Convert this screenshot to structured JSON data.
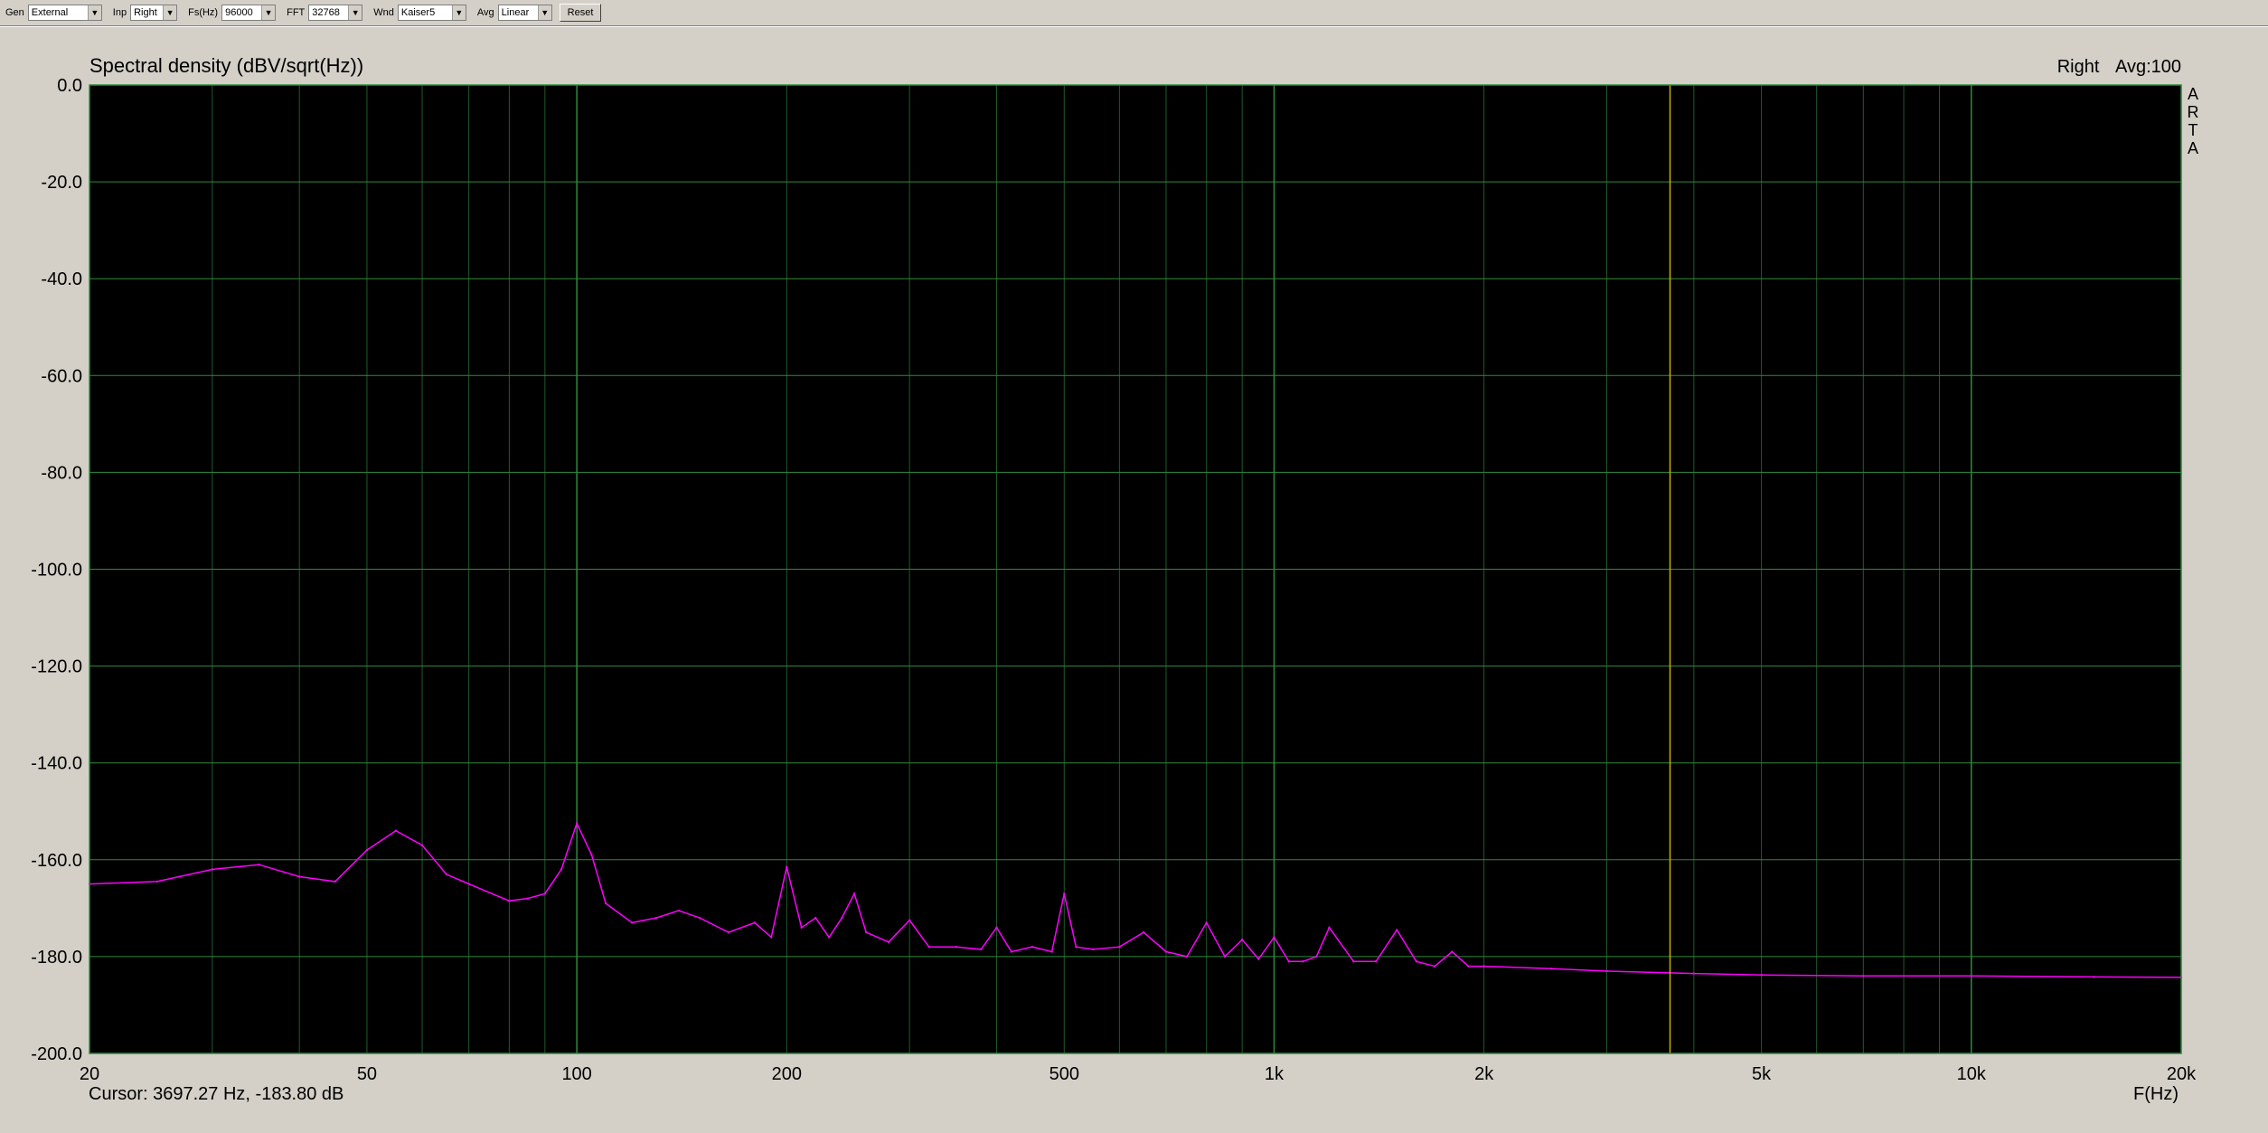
{
  "toolbar": {
    "gen_label": "Gen",
    "gen_value": "External",
    "inp_label": "Inp",
    "inp_value": "Right",
    "fs_label": "Fs(Hz)",
    "fs_value": "96000",
    "fft_label": "FFT",
    "fft_value": "32768",
    "wnd_label": "Wnd",
    "wnd_value": "Kaiser5",
    "avg_label": "Avg",
    "avg_value": "Linear",
    "reset_label": "Reset"
  },
  "status": {
    "channel": "Right",
    "averages": "Avg:100",
    "cursor": "Cursor: 3697.27 Hz, -183.80 dB"
  },
  "watermark": [
    "A",
    "R",
    "T",
    "A"
  ],
  "colors": {
    "plot_background": "#000000",
    "grid": "#1f5a2a",
    "grid_major": "#2e8b3c",
    "trace": "#ff00ff",
    "cursor_line": "#c8b400"
  },
  "chart_data": {
    "type": "line",
    "title": "Spectral density (dBV/sqrt(Hz))",
    "xlabel": "F(Hz)",
    "x_scale": "log",
    "xlim": [
      20,
      20000
    ],
    "ylim": [
      -200,
      0
    ],
    "x_ticks": [
      20,
      50,
      100,
      200,
      500,
      1000,
      2000,
      5000,
      10000,
      20000
    ],
    "x_tick_labels": [
      "20",
      "50",
      "100",
      "200",
      "500",
      "1k",
      "2k",
      "5k",
      "10k",
      "20k"
    ],
    "y_ticks": [
      0,
      -20,
      -40,
      -60,
      -80,
      -100,
      -120,
      -140,
      -160,
      -180,
      -200
    ],
    "y_tick_labels": [
      "0.0",
      "-20.0",
      "-40.0",
      "-60.0",
      "-80.0",
      "-100.0",
      "-120.0",
      "-140.0",
      "-160.0",
      "-180.0",
      "-200.0"
    ],
    "grid": true,
    "cursor_x": 3697.27,
    "series": [
      {
        "x": [
          20,
          25,
          30,
          35,
          40,
          45,
          50,
          55,
          60,
          65,
          70,
          80,
          85,
          90,
          95,
          100,
          105,
          110,
          120,
          130,
          140,
          150,
          165,
          180,
          190,
          200,
          210,
          220,
          230,
          240,
          250,
          260,
          280,
          300,
          320,
          350,
          380,
          400,
          420,
          450,
          480,
          500,
          520,
          550,
          600,
          650,
          700,
          750,
          800,
          850,
          900,
          950,
          1000,
          1050,
          1100,
          1150,
          1200,
          1300,
          1400,
          1500,
          1600,
          1700,
          1800,
          1900,
          2000,
          2500,
          3000,
          4000,
          5000,
          7000,
          10000,
          15000,
          20000
        ],
        "y": [
          -165,
          -164.5,
          -162,
          -161,
          -163.5,
          -164.5,
          -158,
          -154,
          -157,
          -163,
          -165,
          -168.5,
          -168,
          -167,
          -162,
          -152.5,
          -159,
          -169,
          -173,
          -172,
          -170.5,
          -172,
          -175,
          -173,
          -176,
          -161.5,
          -174,
          -172,
          -176,
          -172,
          -167,
          -175,
          -177,
          -172.5,
          -178,
          -178,
          -178.5,
          -174,
          -179,
          -178,
          -179,
          -167,
          -178,
          -178.5,
          -178,
          -175,
          -179,
          -180,
          -173,
          -180,
          -176.5,
          -180.5,
          -176,
          -181,
          -181,
          -180,
          -174,
          -181,
          -181,
          -174.5,
          -181,
          -182,
          -179,
          -182,
          -182,
          -182.5,
          -183,
          -183.5,
          -183.8,
          -184,
          -184,
          -184.2,
          -184.3
        ]
      }
    ]
  }
}
